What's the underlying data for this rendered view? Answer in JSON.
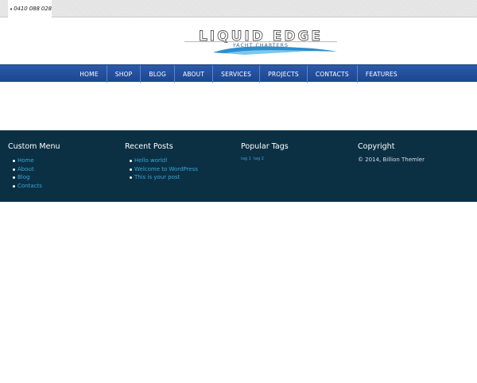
{
  "topbar": {
    "phone": "0410 088 028",
    "phone_icon": "phone-icon"
  },
  "header": {
    "logo_title": "LIQUID EDGE",
    "logo_subtitle": "YACHT CHARTERS"
  },
  "nav": {
    "items": [
      "HOME",
      "SHOP",
      "BLOG",
      "ABOUT",
      "SERVICES",
      "PROJECTS",
      "CONTACTS",
      "FEATURES"
    ]
  },
  "footer": {
    "custom_menu": {
      "title": "Custom Menu",
      "items": [
        "Home",
        "About",
        "Blog",
        "Contacts"
      ]
    },
    "recent_posts": {
      "title": "Recent Posts",
      "items": [
        "Hello world!",
        "Welcome to WordPress",
        "This is your post"
      ]
    },
    "popular_tags": {
      "title": "Popular Tags",
      "tags": [
        "tag 1",
        "tag 2"
      ]
    },
    "copyright": {
      "title": "Copyright",
      "text": "© 2014, Billion Themler"
    }
  },
  "colors": {
    "nav": "#2555a0",
    "footer": "#0b3044",
    "link": "#38a6d8"
  }
}
